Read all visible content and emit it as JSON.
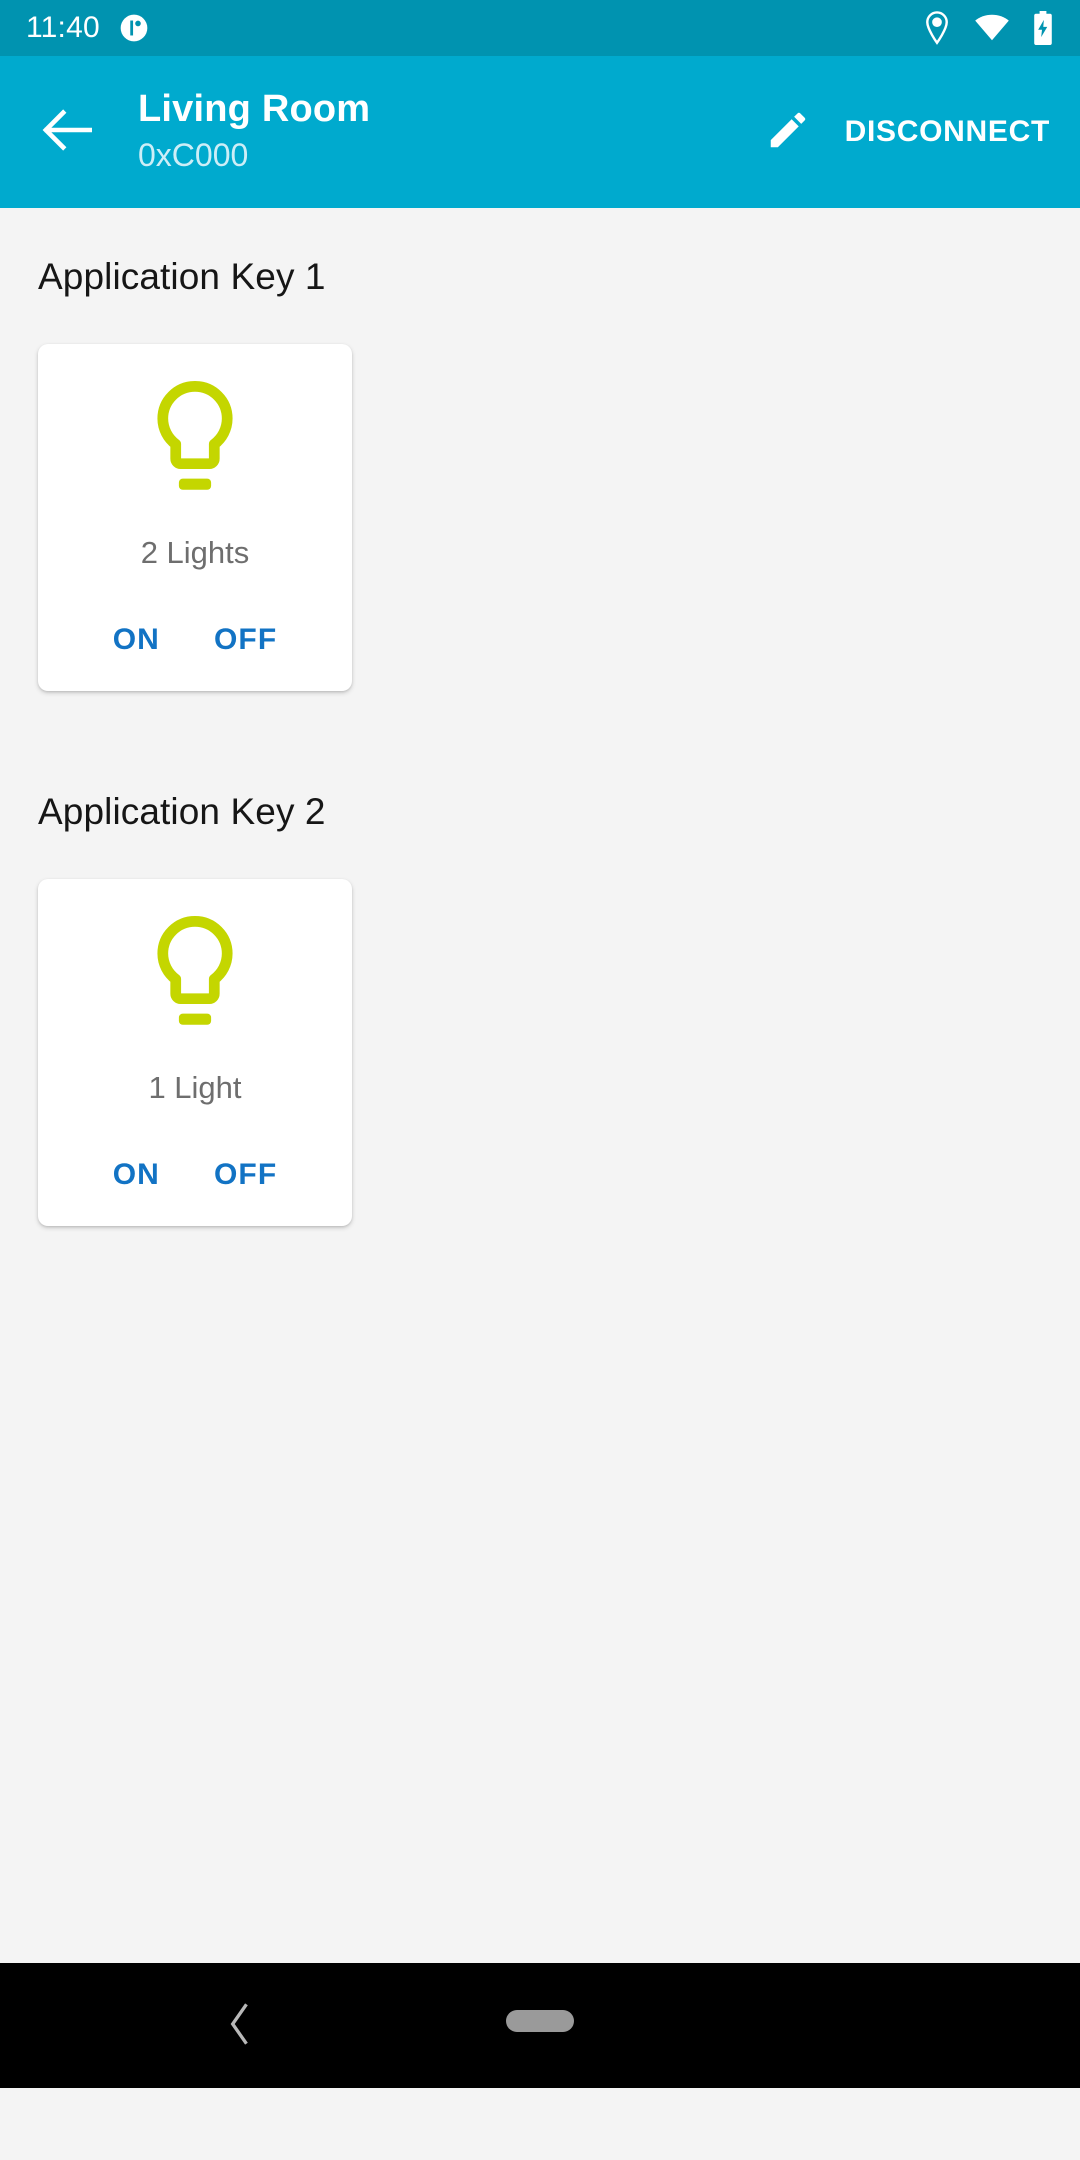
{
  "status_bar": {
    "time": "11:40",
    "app_icon": "notification-circle-icon",
    "icons": [
      "location-pin-icon",
      "wifi-icon",
      "battery-charging-icon"
    ],
    "background_color": "#0093b0",
    "foreground_color": "#ffffff"
  },
  "app_bar": {
    "back_icon": "back-arrow-icon",
    "title": "Living Room",
    "subtitle": "0xC000",
    "edit_icon": "pencil-icon",
    "disconnect_label": "DISCONNECT",
    "background_color": "#00aace",
    "title_color": "#ffffff",
    "subtitle_color": "#cdeef7"
  },
  "content": {
    "background_color": "#f4f4f4",
    "sections": [
      {
        "title": "Application Key 1",
        "card": {
          "icon": "lightbulb-icon",
          "icon_color": "#c4d600",
          "label": "2 Lights",
          "on_label": "ON",
          "off_label": "OFF",
          "button_color": "#1273c4"
        }
      },
      {
        "title": "Application Key 2",
        "card": {
          "icon": "lightbulb-icon",
          "icon_color": "#c4d600",
          "label": "1 Light",
          "on_label": "ON",
          "off_label": "OFF",
          "button_color": "#1273c4"
        }
      }
    ]
  },
  "nav_bar": {
    "background_color": "#000000",
    "back_icon": "nav-back-chevron-icon",
    "home_icon": "nav-home-pill-icon"
  }
}
